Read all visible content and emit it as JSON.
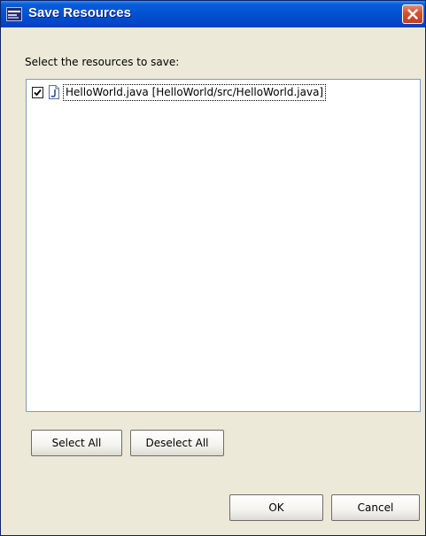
{
  "window": {
    "title": "Save Resources",
    "title_icon": "eclipse-app-icon",
    "close_icon": "close-icon"
  },
  "prompt": {
    "label": "Select the resources to save:"
  },
  "resources": [
    {
      "checked": true,
      "icon": "java-file-icon",
      "label": "HelloWorld.java  [HelloWorld/src/HelloWorld.java]"
    }
  ],
  "buttons": {
    "select_all": "Select All",
    "deselect_all": "Deselect All",
    "ok": "OK",
    "cancel": "Cancel"
  },
  "colors": {
    "titlebar": "#0352d2",
    "dialog_bg": "#ece9d8",
    "close_button": "#d4532f"
  }
}
